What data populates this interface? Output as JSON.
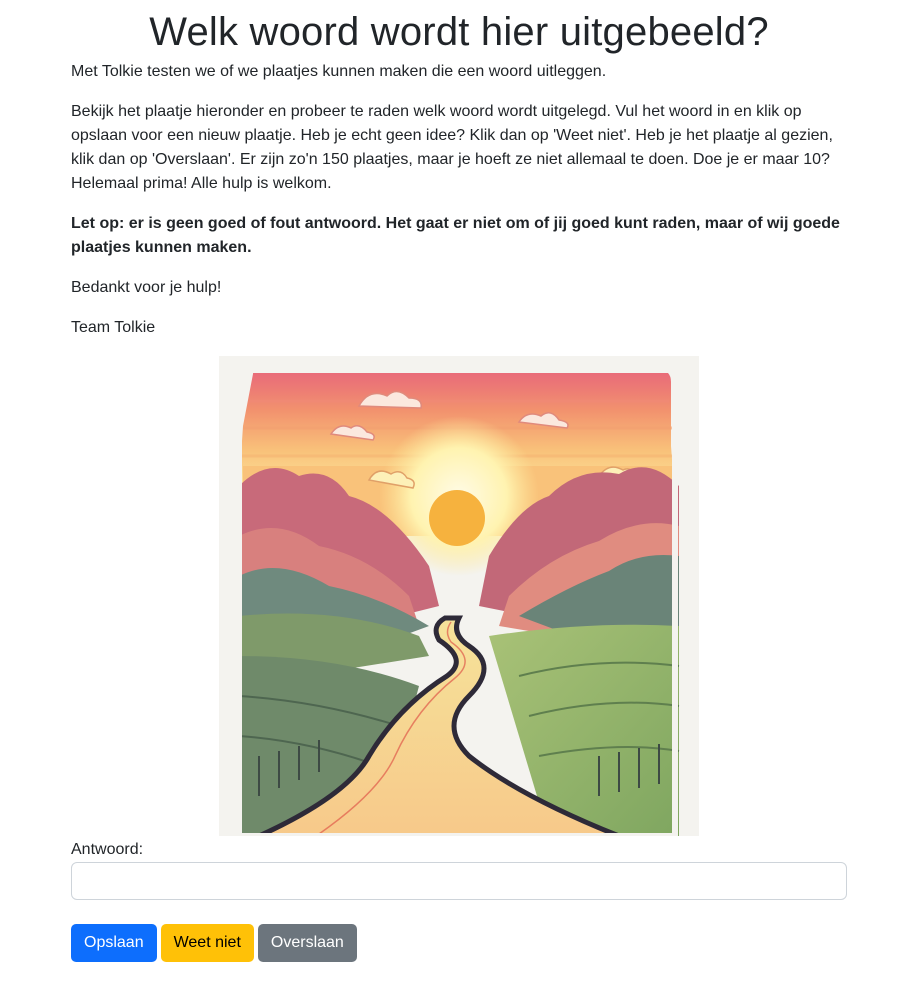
{
  "page": {
    "title": "Welk woord wordt hier uitgebeeld?",
    "paragraphs": {
      "intro": "Met Tolkie testen we of we plaatjes kunnen maken die een woord uitleggen.",
      "instructions": "Bekijk het plaatje hieronder en probeer te raden welk woord wordt uitgelegd. Vul het woord in en klik op opslaan voor een nieuw plaatje. Heb je echt geen idee? Klik dan op 'Weet niet'. Heb je het plaatje al gezien, klik dan op 'Overslaan'. Er zijn zo'n 150 plaatjes, maar je hoeft ze niet allemaal te doen. Doe je er maar 10? Helemaal prima! Alle hulp is welkom.",
      "notice": "Let op: er is geen goed of fout antwoord. Het gaat er niet om of jij goed kunt raden, maar of wij goede plaatjes kunnen maken.",
      "thanks": "Bedankt voor je hulp!",
      "signature": "Team Tolkie"
    }
  },
  "image": {
    "subject": "illustration of a winding road through hills at sunset"
  },
  "form": {
    "answer_label": "Antwoord:",
    "answer_value": "",
    "answer_placeholder": ""
  },
  "buttons": {
    "save": "Opslaan",
    "dont_know": "Weet niet",
    "skip": "Overslaan"
  },
  "colors": {
    "primary": "#0d6efd",
    "warning": "#ffc107",
    "secondary": "#6c757d"
  }
}
